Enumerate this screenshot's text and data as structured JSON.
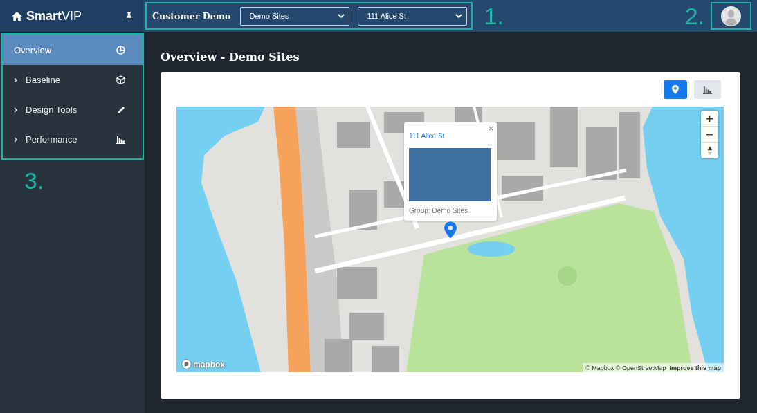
{
  "header": {
    "brand": "**Smart**VIP",
    "context": {
      "annotation": "1.",
      "customer": "Customer Demo",
      "selects": [
        {
          "value": "Demo Sites"
        },
        {
          "value": "111 Alice St"
        }
      ]
    },
    "user": {
      "annotation": "2."
    }
  },
  "sidebar": {
    "annotation": "3.",
    "items": [
      {
        "label": "Overview",
        "kind": "link",
        "selected": true
      },
      {
        "label": "Baseline",
        "kind": "group",
        "selected": false
      },
      {
        "label": "Design Tools",
        "kind": "group",
        "selected": false
      },
      {
        "label": "Performance",
        "kind": "group",
        "selected": false
      }
    ]
  },
  "page": {
    "title": "Overview - Demo Sites",
    "views": [
      {
        "selected": true
      },
      {
        "selected": false
      }
    ],
    "map": {
      "popup": {
        "title": "111 Alice St",
        "group": "Group: Demo Sites"
      },
      "logo": "mapbox",
      "attribution": "© Mapbox © OpenStreetMap",
      "improve_link": "Improve this map"
    }
  }
}
